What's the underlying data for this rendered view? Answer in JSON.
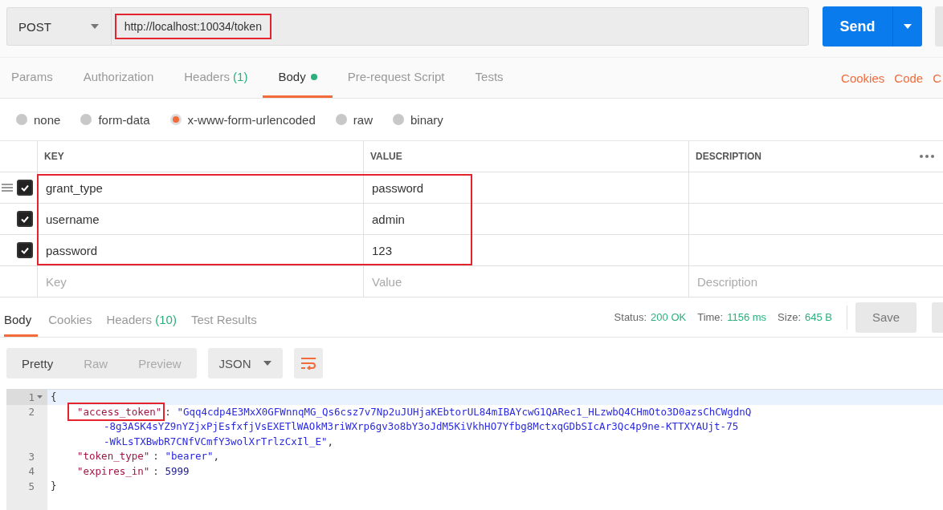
{
  "request": {
    "method": "POST",
    "url": "http://localhost:10034/token",
    "url_highlighted": true,
    "send": "Send"
  },
  "request_tabs": [
    {
      "label": "Params",
      "dot": false,
      "selected": false
    },
    {
      "label": "Authorization",
      "dot": false,
      "selected": false
    },
    {
      "label": "Headers",
      "count": "(1)",
      "dot": false,
      "selected": false
    },
    {
      "label": "Body",
      "dot": true,
      "selected": true
    },
    {
      "label": "Pre-request Script",
      "dot": false,
      "selected": false
    },
    {
      "label": "Tests",
      "dot": false,
      "selected": false
    }
  ],
  "request_links": [
    "Cookies",
    "Code",
    "C"
  ],
  "body_modes": [
    {
      "label": "none",
      "selected": false
    },
    {
      "label": "form-data",
      "selected": false
    },
    {
      "label": "x-www-form-urlencoded",
      "selected": true
    },
    {
      "label": "raw",
      "selected": false
    },
    {
      "label": "binary",
      "selected": false
    }
  ],
  "params_table": {
    "columns": [
      "KEY",
      "VALUE",
      "DESCRIPTION"
    ],
    "highlighted": true,
    "rows": [
      {
        "key": "grant_type",
        "value": "password",
        "checked": true
      },
      {
        "key": "username",
        "value": "admin",
        "checked": true
      },
      {
        "key": "password",
        "value": "123",
        "checked": true
      }
    ],
    "new_row": [
      {
        "placeholder": "Key"
      },
      {
        "placeholder": "Value"
      },
      {
        "placeholder": "Description"
      }
    ]
  },
  "response_tabs": [
    {
      "label": "Body",
      "selected": true
    },
    {
      "label": "Cookies",
      "selected": false
    },
    {
      "label": "Headers",
      "count": "(10)",
      "selected": false
    },
    {
      "label": "Test Results",
      "selected": false
    }
  ],
  "response_status": [
    {
      "label": "Status:",
      "value": "200 OK"
    },
    {
      "label": "Time:",
      "value": "1156 ms"
    },
    {
      "label": "Size:",
      "value": "645 B"
    }
  ],
  "save": "Save",
  "view_modes": [
    {
      "label": "Pretty",
      "selected": true
    },
    {
      "label": "Raw",
      "selected": false
    },
    {
      "label": "Preview",
      "selected": false
    }
  ],
  "format": "JSON",
  "code_lines": [
    {
      "kind": "line",
      "number": "1",
      "fold": true,
      "tokens": [
        {
          "kind": "punct",
          "text": "{"
        }
      ]
    },
    {
      "kind": "line",
      "number": "2",
      "tokens": [
        {
          "kind": "key",
          "text": "\"access_token\"",
          "highlighted": true
        },
        {
          "kind": "punct",
          "text": ": "
        },
        {
          "kind": "string",
          "text": "\"Gqq4cdp4E3MxX0GFWnnqMG_Qs6csz7v7Np2uJUHjaKEbtorUL84mIBAYcwG1QARec1_HLzwbQ4CHmOto3D0azsChCWgdnQ"
        }
      ]
    },
    {
      "kind": "wrap",
      "tokens": [
        {
          "kind": "string",
          "text": "-8g3ASK4sYZ9nYZjxPjEsfxfjVsEXETlWAOkM3riWXrp6gv3o8bY3oJdM5KiVkhHO7Yfbg8MctxqGDbSIcAr3Qc4p9ne-KTTXYAUjt-75"
        }
      ]
    },
    {
      "kind": "wrap",
      "tokens": [
        {
          "kind": "string",
          "text": "-WkLsTXBwbR7CNfVCmfY3wolXrTrlzCxIl_E\""
        },
        {
          "kind": "punct",
          "text": ","
        }
      ]
    },
    {
      "kind": "line",
      "number": "3",
      "tokens": [
        {
          "kind": "key",
          "text": "\"token_type\"",
          "highlighted": false
        },
        {
          "kind": "punct",
          "text": ": "
        },
        {
          "kind": "string",
          "text": "\"bearer\""
        },
        {
          "kind": "punct",
          "text": ","
        }
      ]
    },
    {
      "kind": "line",
      "number": "4",
      "tokens": [
        {
          "kind": "key",
          "text": "\"expires_in\"",
          "highlighted": false
        },
        {
          "kind": "punct",
          "text": ": "
        },
        {
          "kind": "number",
          "text": "5999"
        }
      ]
    },
    {
      "kind": "line",
      "number": "5",
      "tokens": [
        {
          "kind": "punct",
          "text": "}"
        }
      ]
    }
  ]
}
